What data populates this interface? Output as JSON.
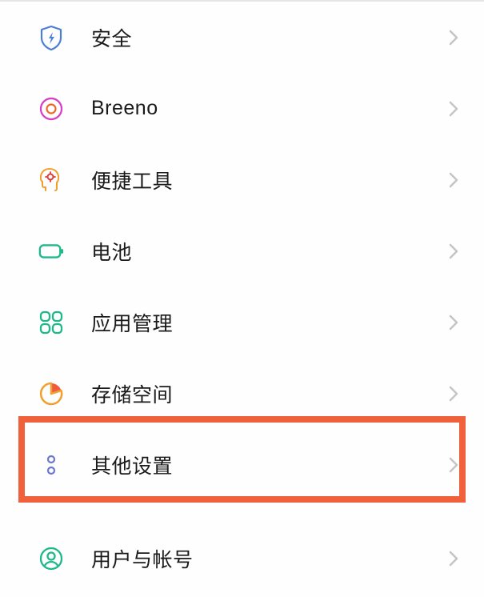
{
  "settings": {
    "items": [
      {
        "label": "安全",
        "icon": "shield-bolt"
      },
      {
        "label": "Breeno",
        "icon": "breeno-circle"
      },
      {
        "label": "便捷工具",
        "icon": "head-gear"
      },
      {
        "label": "电池",
        "icon": "battery"
      },
      {
        "label": "应用管理",
        "icon": "apps-grid"
      },
      {
        "label": "存储空间",
        "icon": "pie-storage"
      },
      {
        "label": "其他设置",
        "icon": "more-dots"
      },
      {
        "label": "用户与帐号",
        "icon": "user-circle"
      }
    ]
  },
  "highlight": {
    "target_index": 6,
    "color": "#f0613b"
  }
}
